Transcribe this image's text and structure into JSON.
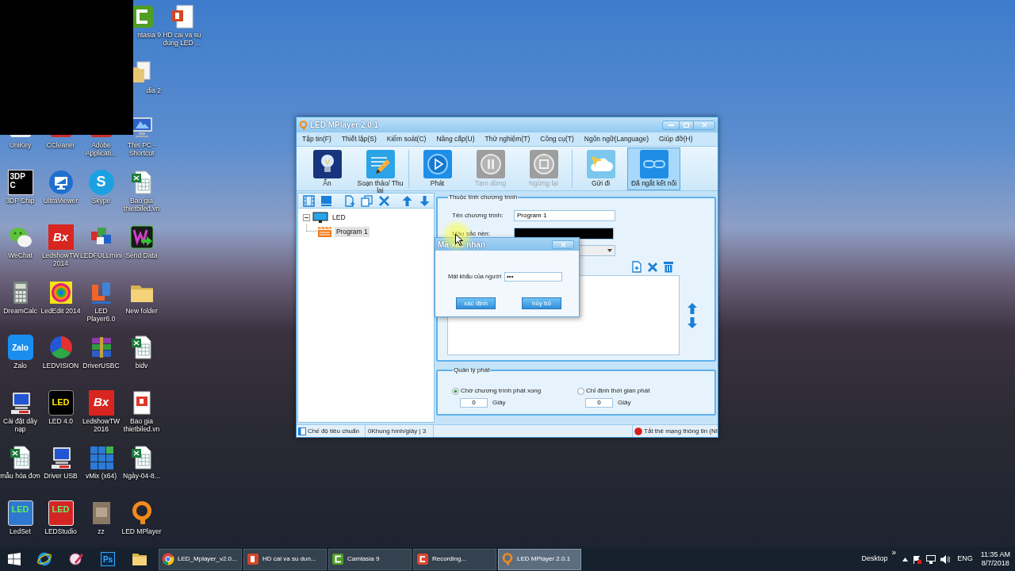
{
  "desktop": {
    "icon_columns": [
      [
        {
          "label": "UniKey",
          "kind": "shortcut"
        },
        {
          "label": "3DP Chip",
          "kind": "shortcut",
          "logo_text": "3DP C"
        },
        {
          "label": "WeChat",
          "kind": "shortcut"
        },
        {
          "label": "DreamCalc",
          "kind": "shortcut"
        },
        {
          "label": "Zalo",
          "kind": "shortcut",
          "logo_text": "Zalo"
        },
        {
          "label": "Cài đặt dây nạp",
          "kind": "shortcut"
        },
        {
          "label": "mẫu hóa đơn",
          "kind": "shortcut"
        },
        {
          "label": "LedSet",
          "kind": "shortcut",
          "logo_text": "LED"
        }
      ],
      [
        {
          "label": "CCleaner",
          "kind": "shortcut"
        },
        {
          "label": "UltraViewer",
          "kind": "shortcut"
        },
        {
          "label": "LedshowTW 2014",
          "kind": "shortcut",
          "logo_text": "Bx"
        },
        {
          "label": "LedEdit 2014",
          "kind": "shortcut"
        },
        {
          "label": "LEDVISION",
          "kind": "shortcut"
        },
        {
          "label": "LED 4.0",
          "kind": "shortcut",
          "logo_text": "LED"
        },
        {
          "label": "Driver USB",
          "kind": "shortcut"
        },
        {
          "label": "LEDStudio",
          "kind": "shortcut",
          "logo_text": "LED"
        }
      ],
      [
        {
          "label": "Adobe Applicati...",
          "kind": "shortcut"
        },
        {
          "label": "Skype",
          "kind": "shortcut",
          "logo_text": "S"
        },
        {
          "label": "LEDFULLmini",
          "kind": "shortcut"
        },
        {
          "label": "LED Player6.0",
          "kind": "shortcut"
        },
        {
          "label": "DriverUSBC",
          "kind": "shortcut"
        },
        {
          "label": "LedshowTW 2016",
          "kind": "shortcut",
          "logo_text": "Bx"
        },
        {
          "label": "vMix (x64)",
          "kind": "shortcut"
        },
        {
          "label": "zz",
          "kind": "shortcut"
        }
      ],
      [
        {
          "label": "ntasia 9",
          "kind": "covered"
        },
        {
          "label": "dia 2",
          "kind": "covered"
        },
        {
          "label": "This PC - Shortcut",
          "kind": "shortcut"
        },
        {
          "label": "Bao gia thietbiled.vn",
          "kind": "shortcut"
        },
        {
          "label": "Send Data",
          "kind": "shortcut"
        },
        {
          "label": "New folder",
          "kind": "shortcut"
        },
        {
          "label": "bidv",
          "kind": "shortcut"
        },
        {
          "label": "Bao gia thietbiled.vn",
          "kind": "shortcut"
        },
        {
          "label": "Ngày-04-8...",
          "kind": "shortcut"
        },
        {
          "label": "LED MPlayer",
          "kind": "shortcut"
        }
      ],
      [
        {
          "label": "HD cai va su dung LED ...",
          "kind": "shortcut"
        }
      ]
    ]
  },
  "window": {
    "title": "LED MPlayer 2.0.1",
    "menu": [
      "Tập tin(F)",
      "Thiết lập(S)",
      "Kiểm soát(C)",
      "Nâng cấp(U)",
      "Thử nghiệm(T)",
      "Công cụ(T)",
      "Ngôn ngữ(Language)",
      "Giúp đỡ(H)"
    ],
    "toolbar": [
      [
        {
          "label": "Ẩn",
          "disabled": false,
          "highlighted": false
        },
        {
          "label": "Soạn thảo/ Thu lại",
          "disabled": false,
          "highlighted": false
        }
      ],
      [
        {
          "label": "Phát",
          "disabled": false,
          "highlighted": false
        },
        {
          "label": "Tạm dừng",
          "disabled": true,
          "highlighted": false
        },
        {
          "label": "Ngừng lại",
          "disabled": true,
          "highlighted": false
        }
      ],
      [
        {
          "label": "Gửi đi",
          "disabled": false,
          "highlighted": false
        },
        {
          "label": "Đã ngắt kết nối",
          "disabled": false,
          "highlighted": true
        }
      ]
    ],
    "program_tree": [
      {
        "label": "LED",
        "expanded": true,
        "selected": false,
        "children": [
          {
            "label": "Program 1",
            "selected": true
          }
        ]
      }
    ],
    "properties": {
      "title": "Thuộc tính chương trình",
      "name_label": "Tên chương trình:",
      "name_value": "Program 1",
      "background_label": "Màu sắc nền:"
    },
    "playback": {
      "title": "Quản lý phát",
      "options": [
        {
          "label": "Chờ chương trình phát xong",
          "selected": true,
          "seconds": "0",
          "unit": "Giây"
        },
        {
          "label": "Chỉ định thời gian phát",
          "selected": false,
          "seconds": "0",
          "unit": "Giây"
        }
      ]
    },
    "status_bar": {
      "mode": "Chế độ tiêu chuẩn",
      "frame_rate": "0Khung hình/giây | 3",
      "network": "Tắt thẻ mạng thông tin (NI"
    }
  },
  "dialog": {
    "title": "Mã xác nhận",
    "password_label": "Mật khẩu của người",
    "password_value": "•••",
    "buttons": [
      "xác định",
      "hủy bỏ"
    ]
  },
  "taskbar": {
    "pinned_logo_text": "Ps",
    "tasks": [
      {
        "label": "LED_Mplayer_v2.0...",
        "selected": false
      },
      {
        "label": "HD cai va su dun...",
        "selected": false
      },
      {
        "label": "Camtasia 9",
        "selected": false
      },
      {
        "label": "Recording...",
        "selected": false
      },
      {
        "label": "LED MPlayer 2.0.1",
        "selected": true
      }
    ],
    "desktop_toolbar": "Desktop",
    "chevron": "»",
    "language": "ENG",
    "time": "11:35 AM",
    "date": "8/7/2018"
  }
}
